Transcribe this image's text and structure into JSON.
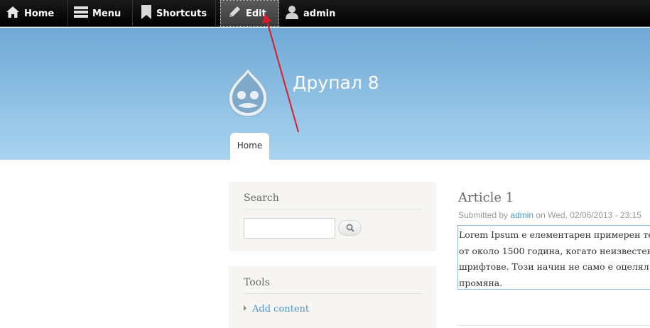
{
  "toolbar": {
    "home_label": "Home",
    "menu_label": "Menu",
    "shortcuts_label": "Shortcuts",
    "edit_label": "Edit",
    "user_label": "admin"
  },
  "header": {
    "site_name": "Друпал 8",
    "nav_tab": "Home"
  },
  "sidebar": {
    "search_title": "Search",
    "search_value": "",
    "tools_title": "Tools",
    "tools_link": "Add content"
  },
  "article": {
    "title": "Article 1",
    "submitted_prefix": "Submitted by",
    "author": "admin",
    "submitted_suffix": "on Wed, 02/06/2013 - 23:15",
    "body_lines": [
      "Lorem Ipsum е елементарен примерен текст",
      "от около 1500 година, когато неизвестен",
      "шрифтове. Този начин не само е оцелял",
      "промяна."
    ]
  },
  "colors": {
    "toolbar_bg": "#000000",
    "header_top": "#6fa9d6",
    "header_bottom": "#a9d3ef",
    "link": "#4d96c9",
    "annotation_arrow": "#dd1a2a"
  }
}
